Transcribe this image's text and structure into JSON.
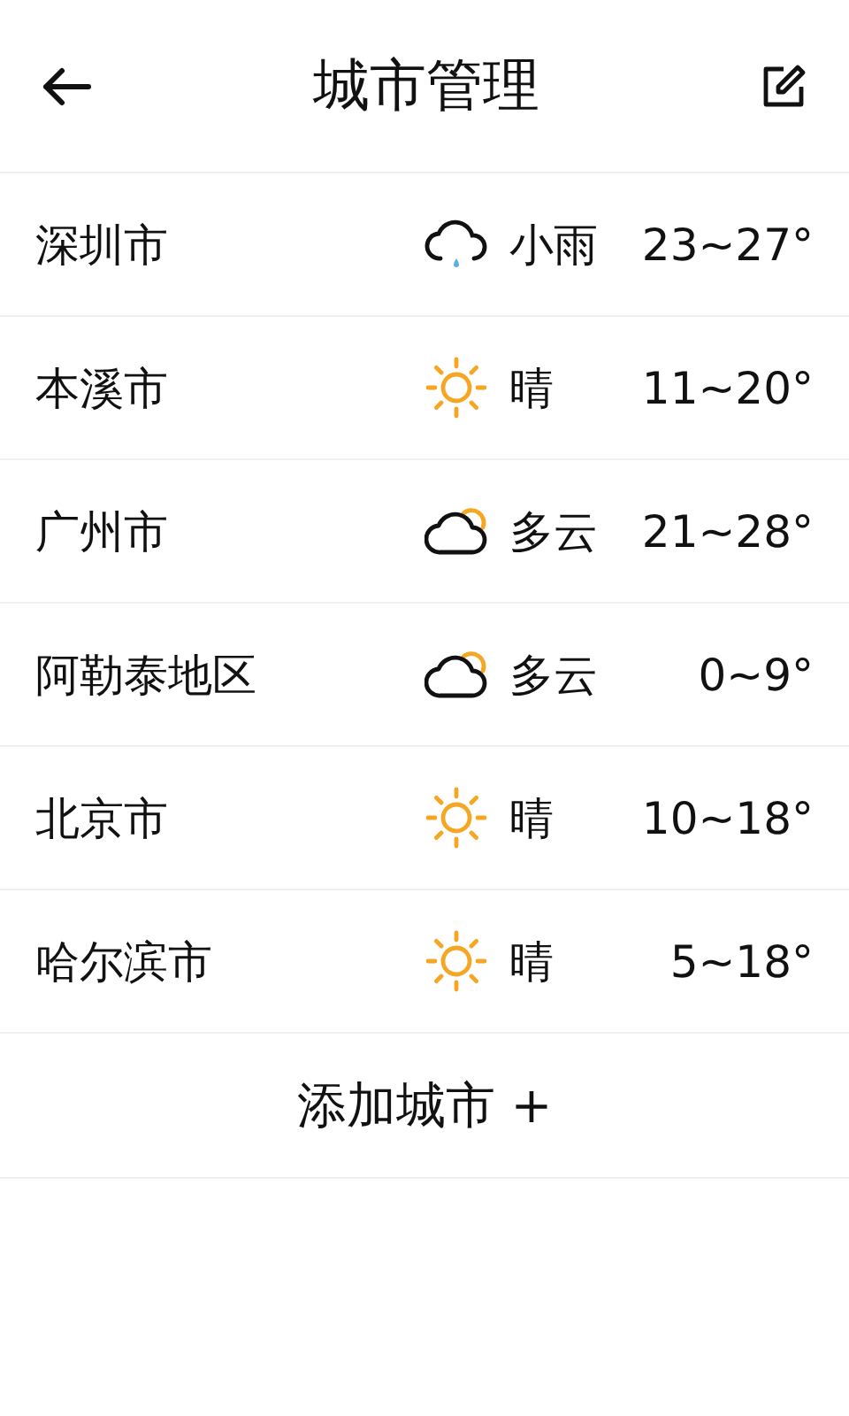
{
  "header": {
    "title": "城市管理"
  },
  "cities": [
    {
      "name": "深圳市",
      "kind": "rain",
      "condition": "小雨",
      "temp": "23~27°"
    },
    {
      "name": "本溪市",
      "kind": "sunny",
      "condition": "晴",
      "temp": "11~20°"
    },
    {
      "name": "广州市",
      "kind": "cloudy",
      "condition": "多云",
      "temp": "21~28°"
    },
    {
      "name": "阿勒泰地区",
      "kind": "cloudy",
      "condition": "多云",
      "temp": "0~9°"
    },
    {
      "name": "北京市",
      "kind": "sunny",
      "condition": "晴",
      "temp": "10~18°"
    },
    {
      "name": "哈尔滨市",
      "kind": "sunny",
      "condition": "晴",
      "temp": "5~18°"
    }
  ],
  "add_city": {
    "label": "添加城市",
    "icon": "+"
  }
}
